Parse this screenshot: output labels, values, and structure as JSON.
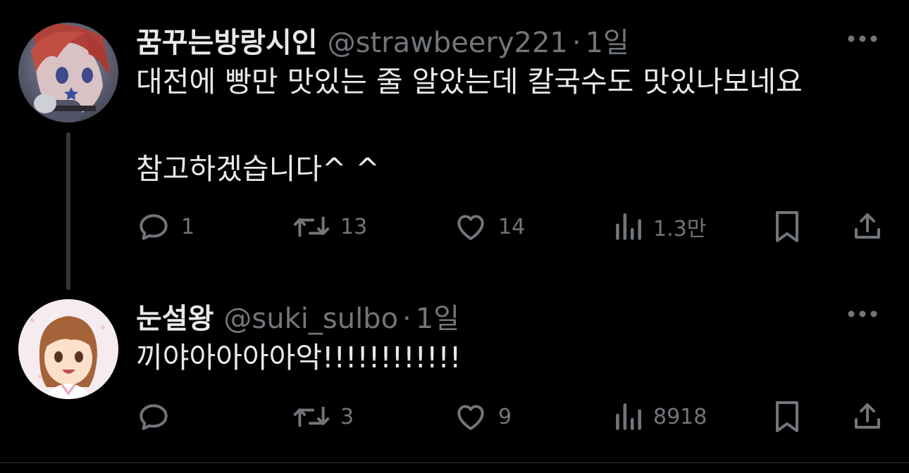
{
  "tweets": [
    {
      "display_name": "꿈꾸는방랑시인",
      "handle": "@strawbeery221",
      "separator": "·",
      "time": "1일",
      "text_line1": "대전에 빵만 맛있는 줄 알았는데 칼국수도 맛있나보네요",
      "text_line2": "참고하겠습니다^ ^",
      "replies": "1",
      "retweets": "13",
      "likes": "14",
      "views": "1.3만"
    },
    {
      "display_name": "눈설왕",
      "handle": "@suki_sulbo",
      "separator": "·",
      "time": "1일",
      "text_line1": "끼야아아아아악!!!!!!!!!!!!",
      "replies": "",
      "retweets": "3",
      "likes": "9",
      "views": "8918"
    }
  ],
  "icons": {
    "reply": "reply-icon",
    "retweet": "retweet-icon",
    "like": "heart-icon",
    "views": "views-chart-icon",
    "bookmark": "bookmark-icon",
    "share": "share-icon",
    "more": "more-dots-icon"
  },
  "colors": {
    "background": "#000000",
    "primary_text": "#e7e9ea",
    "secondary_text": "#71767b",
    "thread_line": "#333639"
  }
}
